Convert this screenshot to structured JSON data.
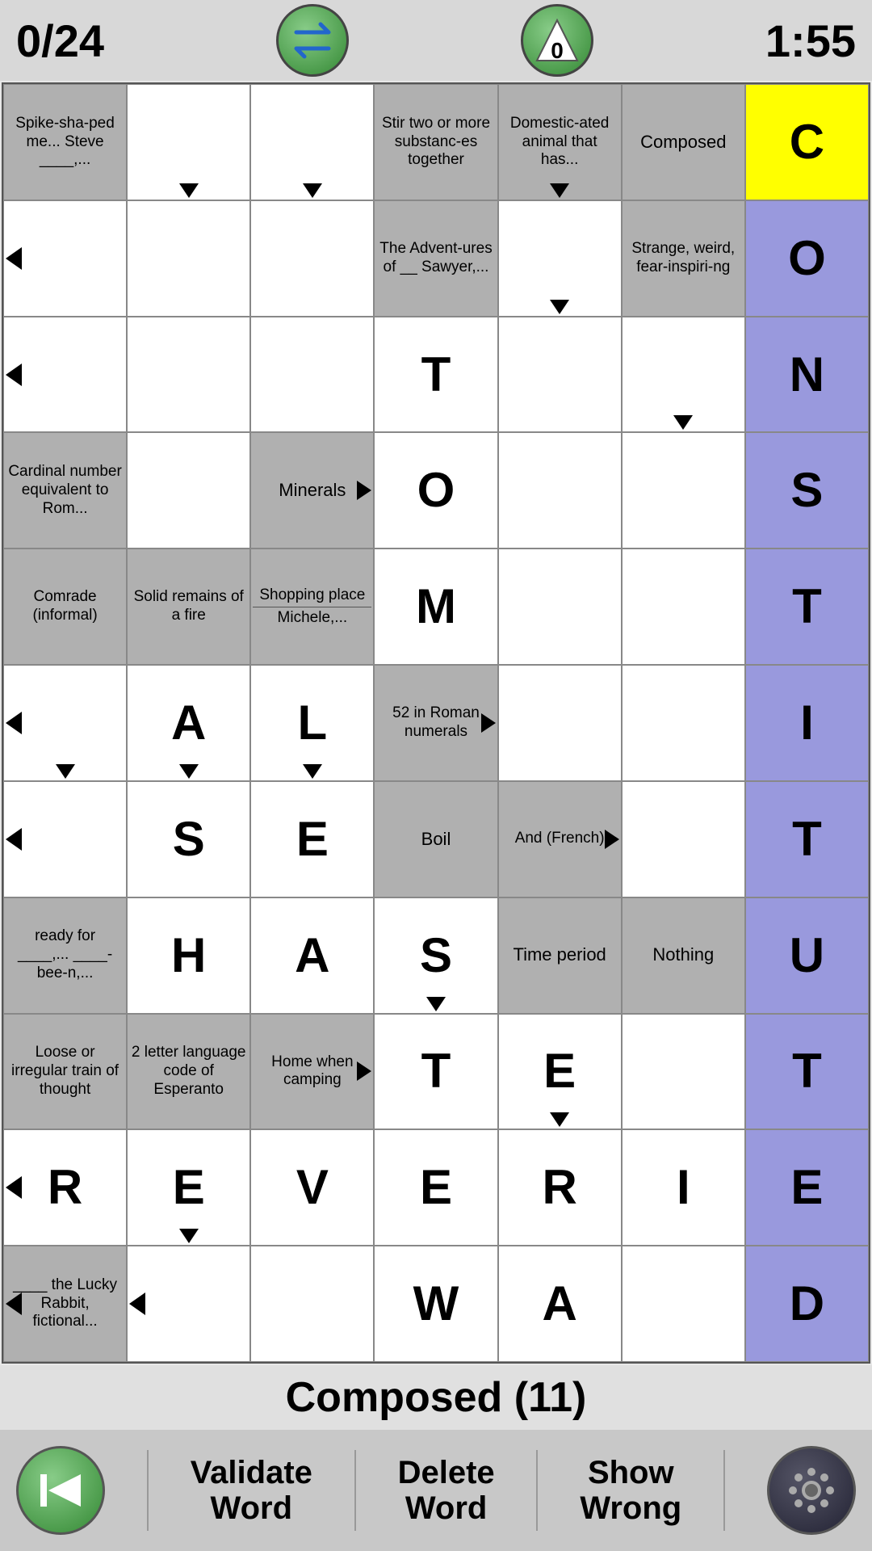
{
  "header": {
    "score": "0/24",
    "timer": "1:55",
    "swap_label": "swap",
    "count_label": "0"
  },
  "status": {
    "text": "Composed (11)"
  },
  "toolbar": {
    "validate_label": "Validate\nWord",
    "delete_label": "Delete\nWord",
    "show_wrong_label": "Show\nWrong"
  },
  "grid": {
    "rows": 11,
    "cols": 7
  }
}
